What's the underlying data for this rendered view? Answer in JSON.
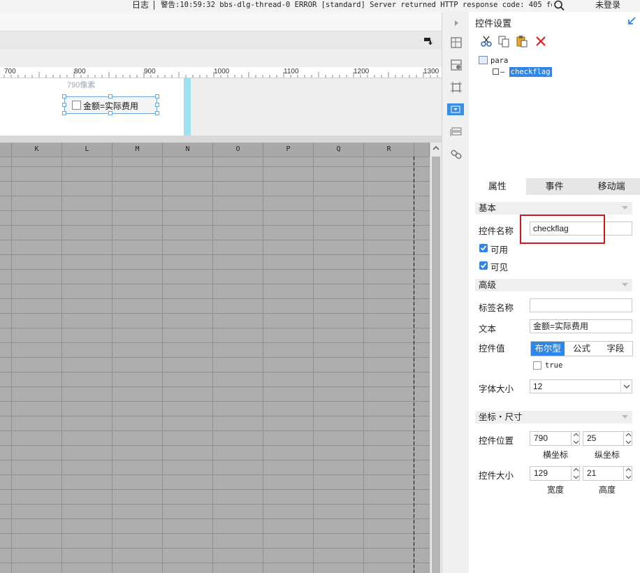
{
  "topbar": {
    "log_label": "日志",
    "message": "警告:10:59:32 bbs-dlg-thread-0 ERROR [standard] Server returned HTTP response code: 405 fo...",
    "login_label": "未登录"
  },
  "ruler": {
    "labels": [
      "700",
      "800",
      "900",
      "1000",
      "1100",
      "1200",
      "1300"
    ]
  },
  "canvas": {
    "coord_label": "790像素",
    "widget_text": "金额=实际费用"
  },
  "grid": {
    "columns": [
      "K",
      "L",
      "M",
      "N",
      "O",
      "P",
      "Q",
      "R"
    ]
  },
  "panel": {
    "title": "控件设置",
    "tree": {
      "root": "para",
      "child": "checkflag"
    },
    "tabs": [
      "属性",
      "事件",
      "移动端"
    ],
    "sections": {
      "basic": "基本",
      "advanced": "高级",
      "coords": "坐标・尺寸"
    },
    "basic": {
      "name_label": "控件名称",
      "name_value": "checkflag",
      "enabled_label": "可用",
      "visible_label": "可见"
    },
    "advanced": {
      "tag_label": "标签名称",
      "tag_value": "",
      "text_label": "文本",
      "text_value": "金额=实际费用",
      "value_label": "控件值",
      "value_modes": [
        "布尔型",
        "公式",
        "字段"
      ],
      "bool_label": "true",
      "fontsize_label": "字体大小",
      "fontsize_value": "12"
    },
    "coords": {
      "pos_label": "控件位置",
      "x_value": "790",
      "y_value": "25",
      "x_caption": "横坐标",
      "y_caption": "纵坐标",
      "size_label": "控件大小",
      "w_value": "129",
      "h_value": "21",
      "w_caption": "宽度",
      "h_caption": "高度"
    }
  },
  "colors": {
    "accent": "#2f86e8",
    "highlight_box": "#d6151b",
    "cyan_marker": "#9be3ee"
  }
}
